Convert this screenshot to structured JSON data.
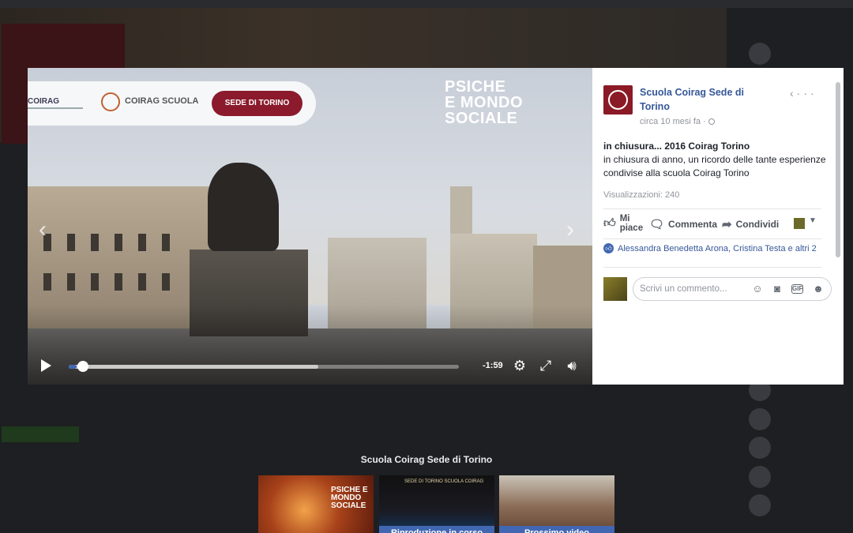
{
  "video": {
    "banner": {
      "brand_left": "COIRAG",
      "brand_right": "COIRAG SCUOLA",
      "sede_label": "SEDE DI TORINO"
    },
    "title_lines": [
      "PSICHE",
      "E MONDO",
      "SOCIALE"
    ],
    "nav_prev": "‹",
    "nav_next": "›",
    "remaining_time": "-1:59",
    "progress_played": 0.02,
    "progress_buffered": 0.64
  },
  "post": {
    "page_name": "Scuola Coirag Sede di Torino",
    "time_ago": "circa 10 mesi fa ·",
    "title": "in chiusura... 2016 Coirag Torino",
    "text": "in chiusura di anno, un ricordo delle tante esperienze condivise alla scuola Coirag Torino",
    "views": "Visualizzazioni: 240",
    "actions": {
      "like": "Mi piace",
      "comment": "Commenta",
      "share": "Condividi"
    },
    "likers": "Alessandra Benedetta Arona, Cristina Testa e altri 2",
    "comment_placeholder": "Scrivi un commento..."
  },
  "related": {
    "title": "Scuola Coirag Sede di Torino",
    "items": [
      {
        "label": "",
        "overlay": "PSICHE E MONDO SOCIALE"
      },
      {
        "label": "Riproduzione in corso",
        "overlay": "SEDE DI TORINO SCUOLA COIRAG"
      },
      {
        "label": "Prossimo video",
        "overlay": ""
      }
    ]
  },
  "colors": {
    "accent": "#4267b2",
    "link": "#365899",
    "sede_badge": "#8b1b2c",
    "dim_background": "#1e1f22"
  },
  "icons": {
    "play": "play-icon",
    "settings": "gear-icon",
    "fullscreen": "fullscreen-icon",
    "volume": "volume-icon"
  }
}
